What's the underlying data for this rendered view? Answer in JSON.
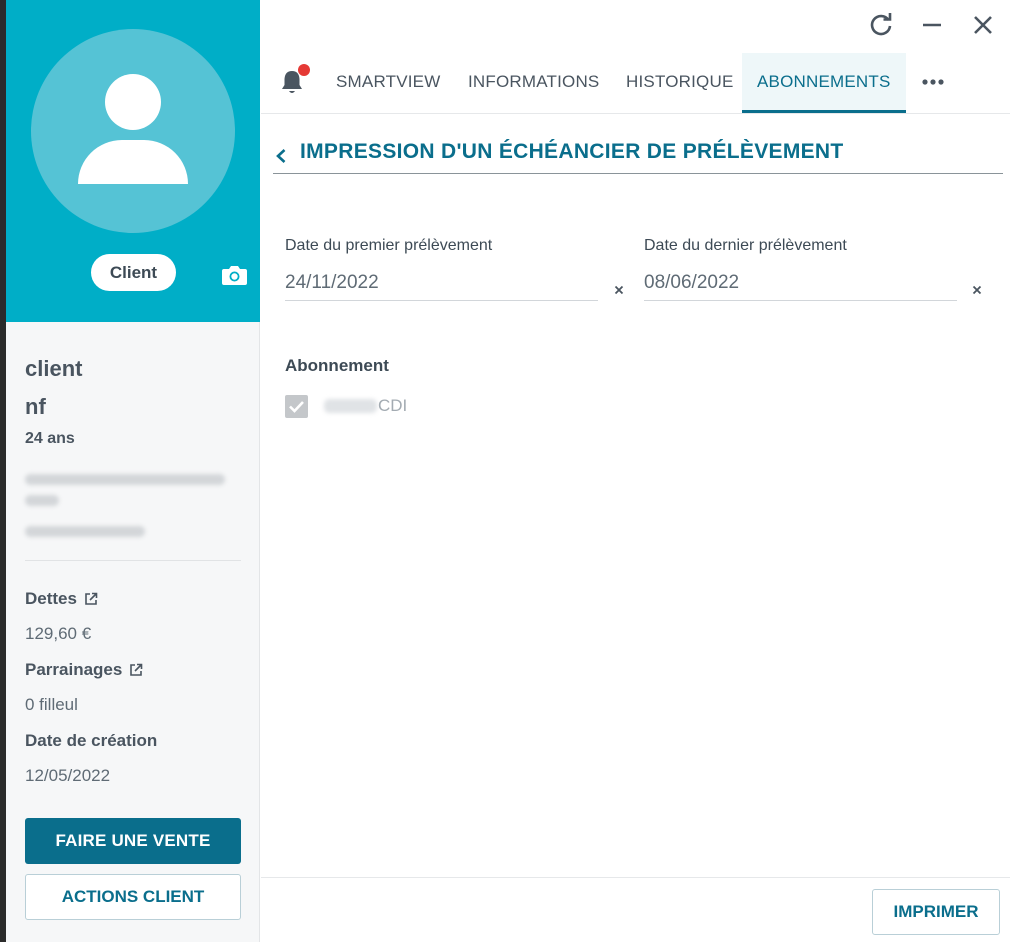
{
  "profile": {
    "badge": "Client",
    "name_line1": "client",
    "name_line2": "nf",
    "age": "24 ans",
    "address_blurred": "3 Magic Parmi Bouyrain Bris",
    "phone_blurred": "0770508803"
  },
  "sidebar": {
    "dettes_label": "Dettes",
    "dettes_value": "129,60 €",
    "parrainages_label": "Parrainages",
    "parrainages_value": "0 filleul",
    "creation_label": "Date de création",
    "creation_value": "12/05/2022",
    "sale_button": "FAIRE UNE VENTE",
    "actions_button": "ACTIONS CLIENT"
  },
  "tabs": [
    {
      "label": "SMARTVIEW"
    },
    {
      "label": "INFORMATIONS"
    },
    {
      "label": "HISTORIQUE"
    },
    {
      "label": "ABONNEMENTS",
      "active": true
    }
  ],
  "page": {
    "title": "IMPRESSION D'UN ÉCHÉANCIER DE PRÉLÈVEMENT",
    "first_date_label": "Date du premier prélèvement",
    "first_date_value": "24/11/2022",
    "last_date_label": "Date du dernier prélèvement",
    "last_date_value": "08/06/2022",
    "subscription_label": "Abonnement",
    "subscription_item": "CDI",
    "subscription_checked": true
  },
  "footer": {
    "print_button": "IMPRIMER"
  },
  "colors": {
    "accent": "#00aec7",
    "primary": "#0a6e8c",
    "notification": "#e53935"
  },
  "icons": [
    "user-avatar-icon",
    "camera-icon",
    "external-link-icon",
    "refresh-icon",
    "minimize-icon",
    "close-icon",
    "bell-icon",
    "more-icon",
    "chevron-left-icon",
    "clear-icon",
    "checkbox-checked-icon"
  ]
}
